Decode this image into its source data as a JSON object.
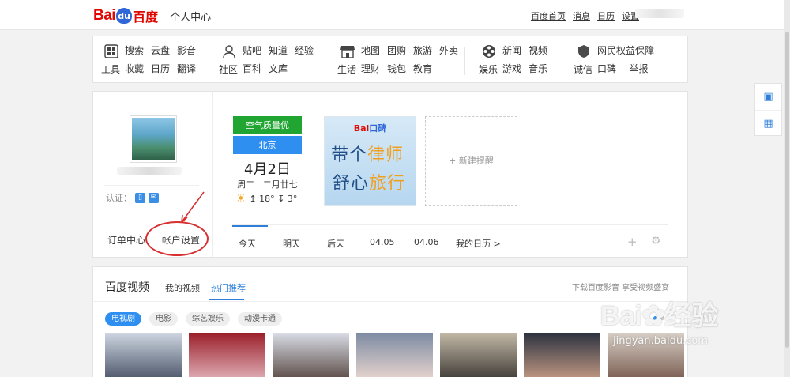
{
  "header": {
    "logo_bai": "Bai",
    "logo_paw": "du",
    "logo_du": "百度",
    "logo_center": "个人中心",
    "links": [
      "百度首页",
      "消息",
      "日历",
      "设置"
    ]
  },
  "nav": {
    "groups": [
      {
        "label": "工具",
        "icon": "grid-icon",
        "links": [
          "搜索",
          "云盘",
          "影音",
          "收藏",
          "日历",
          "翻译"
        ]
      },
      {
        "label": "社区",
        "icon": "person-icon",
        "links": [
          "贴吧",
          "知道",
          "经验",
          "百科",
          "文库"
        ]
      },
      {
        "label": "生活",
        "icon": "shop-icon",
        "links": [
          "地图",
          "团购",
          "旅游",
          "外卖",
          "理财",
          "钱包",
          "教育"
        ]
      },
      {
        "label": "娱乐",
        "icon": "film-reel-icon",
        "links": [
          "新闻",
          "视频",
          "游戏",
          "音乐"
        ]
      },
      {
        "label": "诚信",
        "icon": "shield-icon",
        "links": [
          "网民权益保障",
          "口碑",
          "举报"
        ]
      }
    ]
  },
  "profile": {
    "auth_label": "认证：",
    "order_center": "订单中心",
    "account_settings": "帐户设置"
  },
  "calendar": {
    "air_quality": "空气质量优",
    "city": "北京",
    "date": "4月2日",
    "weekday": "周二",
    "lunar": "二月廿七",
    "temp": "↥ 18° ↧ 3°"
  },
  "ad": {
    "logo_bai": "Bai",
    "logo_rest": "口碑",
    "line1_a": "带个",
    "line1_b": "律师",
    "line2_a": "舒心",
    "line2_b": "旅行"
  },
  "reminder": {
    "label": "+ 新建提醒"
  },
  "cal_tabs": [
    "今天",
    "明天",
    "后天",
    "04.05",
    "04.06",
    "我的日历 >"
  ],
  "video": {
    "title": "百度视频",
    "tab_mine": "我的视频",
    "tab_hot": "热门推荐",
    "download": "下载百度影音 享受视频盛宴",
    "categories": [
      "电视剧",
      "电影",
      "综艺娱乐",
      "动漫卡通"
    ],
    "thumbs": [
      {
        "c1": "#cfd6e2",
        "c2": "#4a5568"
      },
      {
        "c1": "#9b1f2a",
        "c2": "#e0b0b8"
      },
      {
        "c1": "#d9dde6",
        "c2": "#5a4a44"
      },
      {
        "c1": "#7d8ba3",
        "c2": "#e9d6cf"
      },
      {
        "c1": "#c2b8a6",
        "c2": "#3e3a36"
      },
      {
        "c1": "#2c3240",
        "c2": "#c49a84"
      },
      {
        "c1": "#d7cfc6",
        "c2": "#7a5c50"
      }
    ]
  },
  "watermark": {
    "brand": "Bai",
    "brand2": "经验",
    "url": "jingyan.baidu.com"
  }
}
